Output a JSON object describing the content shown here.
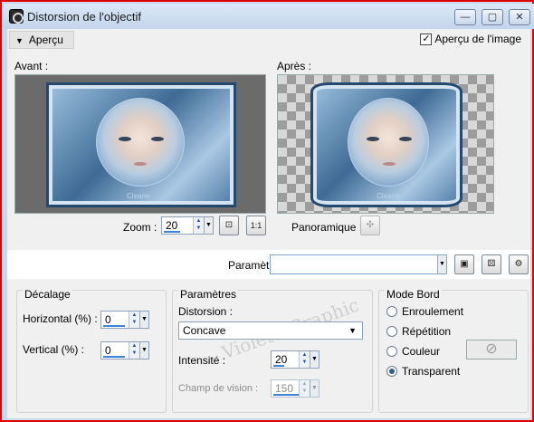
{
  "window": {
    "title": "Distorsion de l'objectif",
    "controls": [
      "—",
      "▢",
      "✕"
    ]
  },
  "preview_bar": {
    "toggle_label": "Aperçu",
    "checkbox_label": "Aperçu de l'image",
    "checkbox_checked": true
  },
  "before_label": "Avant :",
  "after_label": "Après :",
  "image": {
    "signature": "Cleane"
  },
  "zoom": {
    "label": "Zoom :",
    "value": "20"
  },
  "pan": {
    "label": "Panoramique :"
  },
  "presets": {
    "label": "Paramètres",
    "value": ""
  },
  "offset": {
    "title": "Décalage",
    "horizontal_label": "Horizontal (%) :",
    "horizontal_value": "0",
    "vertical_label": "Vertical (%) :",
    "vertical_value": "0"
  },
  "params": {
    "title": "Paramètres",
    "distortion_label": "Distorsion :",
    "distortion_value": "Concave",
    "intensity_label": "Intensité :",
    "intensity_value": "20",
    "fov_label": "Champ de vision :",
    "fov_value": "150"
  },
  "edge_mode": {
    "title": "Mode Bord",
    "options": [
      "Enroulement",
      "Répétition",
      "Couleur",
      "Transparent"
    ],
    "selected": "Transparent"
  },
  "watermark": "VioletteGraphic",
  "colors": {
    "accent": "#3d84d8",
    "frame": "#e00000",
    "panel": "#f0f0f0"
  }
}
